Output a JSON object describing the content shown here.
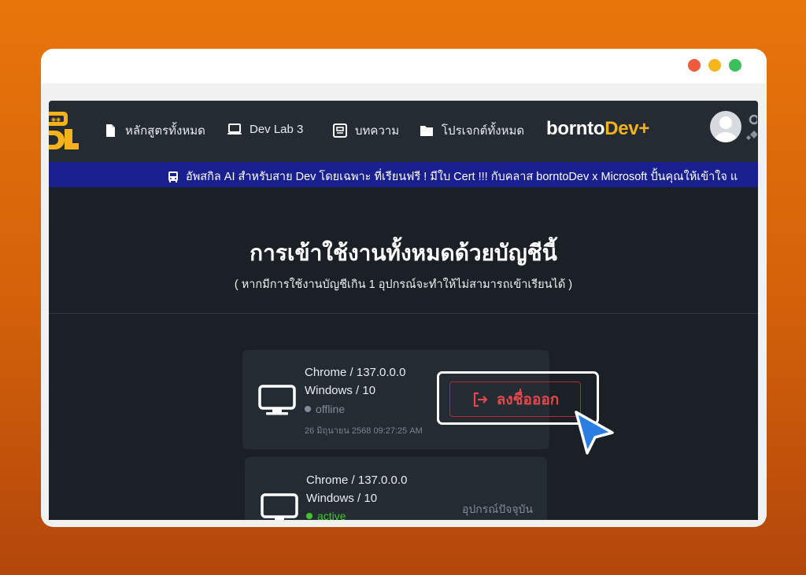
{
  "navbar": {
    "items": [
      {
        "label": "หลักสูตรทั้งหมด",
        "icon": "file-icon"
      },
      {
        "label": "Dev Lab 3",
        "icon": "laptop-icon"
      },
      {
        "label": "บทความ",
        "icon": "article-icon"
      },
      {
        "label": "โปรเจกต์ทั้งหมด",
        "icon": "folder-icon"
      }
    ],
    "brand_main": "bornto",
    "brand_accent": "Dev+"
  },
  "ticker": {
    "text": "อัพสกิล AI สำหรับสาย Dev โดยเฉพาะ ที่เรียนฟรี ! มีใบ Cert !!! กับคลาส borntoDev x Microsoft ปั้นคุณให้เข้าใจ แ"
  },
  "page": {
    "title": "การเข้าใช้งานทั้งหมดด้วยบัญชีนี้",
    "subtitle": "( หากมีการใช้งานบัญชีเกิน 1 อุปกรณ์จะทำให้ไม่สามารถเข้าเรียนได้ )"
  },
  "sessions": [
    {
      "browser": "Chrome / 137.0.0.0",
      "os": "Windows / 10",
      "status": "offline",
      "timestamp": "26 มิถุนายน 2568 09:27:25 AM",
      "action_label": "ลงชื่อออก"
    },
    {
      "browser": "Chrome / 137.0.0.0",
      "os": "Windows / 10",
      "status": "active",
      "current_label": "อุปกรณ์ปัจจุบัน"
    }
  ],
  "colors": {
    "background_orange": "#e8750a",
    "app_background": "#1b2027",
    "card": "#242b33",
    "ticker": "#191f8f",
    "accent_yellow": "#f7b21b",
    "logout_red": "#e6474b",
    "active_green": "#41c52d",
    "cursor_blue": "#2a7de1"
  }
}
